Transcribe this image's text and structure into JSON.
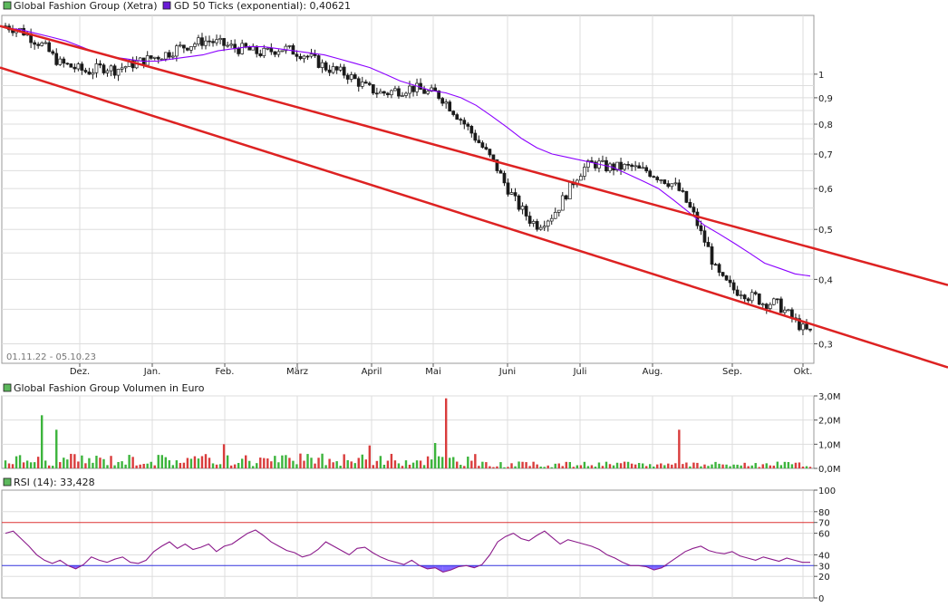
{
  "colors": {
    "price_up": "#ffffff",
    "price_down": "#1a1a1a",
    "ma": "#8b00ff",
    "trend": "#dd2222",
    "volume_up": "#3cb43c",
    "volume_down": "#d93c3c",
    "rsi": "#8b1a8b",
    "rsi_fill": "#6040ff",
    "line70": "#dd3333",
    "line30": "#3333dd",
    "grid": "#dddddd"
  },
  "chart_data": [
    {
      "type": "candlestick",
      "legend": [
        {
          "label": "Global Fashion Group (Xetra)",
          "color": "#5cb85c"
        },
        {
          "label": "GD 50 Ticks (exponential): 0,40621",
          "color": "#6a1bd6"
        }
      ],
      "date_range": "01.11.22 - 05.10.23",
      "x_tick_labels": [
        "Dez.",
        "Jan.",
        "Feb.",
        "März",
        "April",
        "Mai",
        "Juni",
        "Juli",
        "Aug.",
        "Sep.",
        "Okt."
      ],
      "y_tick_labels": [
        "1",
        "0,9",
        "0,8",
        "0,7",
        "0,6",
        "0,5",
        "0,4",
        "0,3"
      ],
      "y_scale": "log",
      "ylim": [
        0.275,
        1.3
      ],
      "close": [
        1.24,
        1.23,
        1.22,
        1.2,
        1.17,
        1.15,
        1.12,
        1.08,
        1.05,
        1.04,
        1.03,
        1.02,
        1.01,
        1.02,
        1.03,
        1.03,
        1.02,
        1.03,
        1.04,
        1.05,
        1.06,
        1.07,
        1.08,
        1.09,
        1.1,
        1.12,
        1.13,
        1.14,
        1.15,
        1.16,
        1.16,
        1.15,
        1.14,
        1.13,
        1.12,
        1.12,
        1.11,
        1.1,
        1.1,
        1.11,
        1.12,
        1.12,
        1.11,
        1.1,
        1.09,
        1.07,
        1.05,
        1.03,
        1.02,
        1.01,
        1.0,
        0.98,
        0.96,
        0.94,
        0.93,
        0.92,
        0.92,
        0.93,
        0.93,
        0.94,
        0.94,
        0.93,
        0.92,
        0.92,
        0.9,
        0.87,
        0.84,
        0.81,
        0.78,
        0.75,
        0.72,
        0.69,
        0.66,
        0.62,
        0.59,
        0.56,
        0.54,
        0.52,
        0.51,
        0.52,
        0.53,
        0.55,
        0.58,
        0.61,
        0.64,
        0.66,
        0.67,
        0.67,
        0.66,
        0.66,
        0.66,
        0.66,
        0.66,
        0.65,
        0.65,
        0.64,
        0.63,
        0.62,
        0.61,
        0.59,
        0.56,
        0.53,
        0.49,
        0.46,
        0.42,
        0.4,
        0.39,
        0.38,
        0.38,
        0.37,
        0.37,
        0.36,
        0.36,
        0.36,
        0.35,
        0.34,
        0.33,
        0.32,
        0.315
      ],
      "ma": [
        1.23,
        1.22,
        1.2,
        1.18,
        1.16,
        1.13,
        1.1,
        1.08,
        1.07,
        1.06,
        1.06,
        1.07,
        1.08,
        1.09,
        1.11,
        1.12,
        1.13,
        1.13,
        1.12,
        1.11,
        1.1,
        1.09,
        1.07,
        1.05,
        1.03,
        1.0,
        0.97,
        0.95,
        0.93,
        0.92,
        0.9,
        0.87,
        0.83,
        0.79,
        0.75,
        0.72,
        0.7,
        0.69,
        0.68,
        0.67,
        0.66,
        0.64,
        0.62,
        0.6,
        0.57,
        0.54,
        0.51,
        0.49,
        0.47,
        0.45,
        0.43,
        0.42,
        0.41,
        0.406
      ],
      "trend_channel": {
        "upper": [
          {
            "x": "01.11.22",
            "y": 1.24
          },
          {
            "x": "31.10.23",
            "y": 0.39
          }
        ],
        "lower": [
          {
            "x": "01.11.22",
            "y": 1.03
          },
          {
            "x": "31.10.23",
            "y": 0.27
          }
        ]
      }
    },
    {
      "type": "bar",
      "legend": [
        {
          "label": "Global Fashion Group Volumen in Euro",
          "color": "#5cb85c"
        }
      ],
      "y_tick_labels": [
        "3,0M",
        "2,0M",
        "1,0M",
        "0,0M"
      ],
      "ylim": [
        0,
        3000000
      ],
      "spikes": [
        {
          "index": 10,
          "value": 2200000
        },
        {
          "index": 14,
          "value": 1600000
        },
        {
          "index": 60,
          "value": 1000000
        },
        {
          "index": 100,
          "value": 950000
        },
        {
          "index": 118,
          "value": 1050000
        },
        {
          "index": 121,
          "value": 2900000
        },
        {
          "index": 185,
          "value": 1600000
        }
      ],
      "typical_value": 250000
    },
    {
      "type": "line",
      "legend": [
        {
          "label": "RSI (14): 33,428",
          "color": "#5cb85c"
        }
      ],
      "y_tick_labels": [
        "100",
        "80",
        "70",
        "60",
        "40",
        "30",
        "20",
        "0"
      ],
      "ylim": [
        0,
        100
      ],
      "reference_lines": [
        70,
        30
      ],
      "values": [
        60,
        62,
        55,
        48,
        40,
        35,
        32,
        35,
        30,
        27,
        31,
        38,
        35,
        33,
        36,
        38,
        33,
        32,
        35,
        43,
        48,
        52,
        46,
        50,
        45,
        47,
        50,
        43,
        48,
        50,
        55,
        60,
        63,
        58,
        52,
        48,
        44,
        42,
        38,
        40,
        45,
        52,
        48,
        44,
        40,
        46,
        47,
        42,
        38,
        35,
        33,
        31,
        35,
        30,
        27,
        28,
        24,
        26,
        29,
        30,
        28,
        31,
        40,
        52,
        57,
        60,
        55,
        53,
        58,
        62,
        56,
        50,
        54,
        52,
        50,
        48,
        45,
        40,
        37,
        33,
        30,
        30,
        29,
        26,
        28,
        33,
        38,
        43,
        46,
        48,
        44,
        42,
        41,
        43,
        39,
        37,
        35,
        38,
        36,
        34,
        37,
        35,
        33,
        33
      ]
    }
  ]
}
